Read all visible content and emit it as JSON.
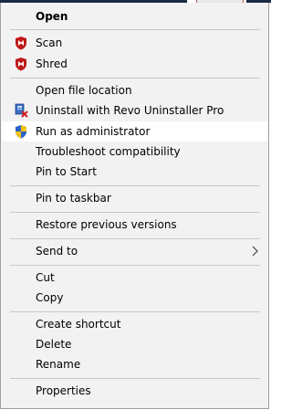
{
  "menu": {
    "open": "Open",
    "scan": "Scan",
    "shred": "Shred",
    "open_location": "Open file location",
    "uninstall_revo": "Uninstall with Revo Uninstaller Pro",
    "run_admin": "Run as administrator",
    "troubleshoot": "Troubleshoot compatibility",
    "pin_start": "Pin to Start",
    "pin_taskbar": "Pin to taskbar",
    "restore_versions": "Restore previous versions",
    "send_to": "Send to",
    "cut": "Cut",
    "copy": "Copy",
    "create_shortcut": "Create shortcut",
    "delete": "Delete",
    "rename": "Rename",
    "properties": "Properties"
  },
  "icons": {
    "scan": "mcafee-shield-icon",
    "shred": "mcafee-shield-icon",
    "uninstall_revo": "revo-uninstaller-icon",
    "run_admin": "uac-shield-icon",
    "send_to": "chevron-right-icon"
  },
  "colors": {
    "menu_bg": "#f2f2f2",
    "highlight": "#ffffff",
    "mcafee_red": "#c01818",
    "separator": "#c8c8c8"
  }
}
